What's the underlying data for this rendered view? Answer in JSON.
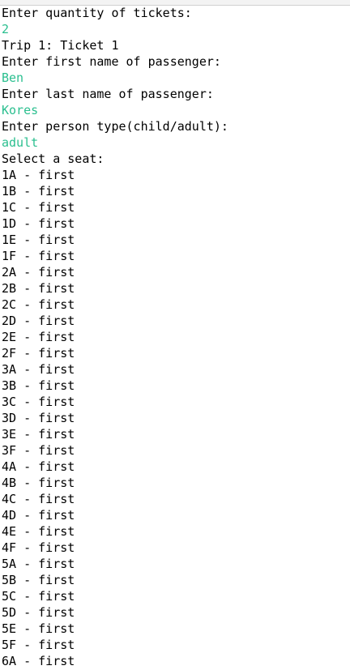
{
  "console": {
    "prompt_quantity": "Enter quantity of tickets:",
    "input_quantity": "2",
    "trip_header": "Trip 1: Ticket 1",
    "prompt_first_name": "Enter first name of passenger:",
    "input_first_name": "Ben",
    "prompt_last_name": "Enter last name of passenger:",
    "input_last_name": "Kores",
    "prompt_person_type": "Enter person type(child/adult):",
    "input_person_type": "adult",
    "prompt_seat": "Select a seat:",
    "seats": [
      "1A - first",
      "1B - first",
      "1C - first",
      "1D - first",
      "1E - first",
      "1F - first",
      "2A - first",
      "2B - first",
      "2C - first",
      "2D - first",
      "2E - first",
      "2F - first",
      "3A - first",
      "3B - first",
      "3C - first",
      "3D - first",
      "3E - first",
      "3F - first",
      "4A - first",
      "4B - first",
      "4C - first",
      "4D - first",
      "4E - first",
      "4F - first",
      "5A - first",
      "5B - first",
      "5C - first",
      "5D - first",
      "5E - first",
      "5F - first",
      "6A - first"
    ]
  },
  "colors": {
    "user_input": "#2bbf8f",
    "output_text": "#000000",
    "background": "#ffffff"
  }
}
